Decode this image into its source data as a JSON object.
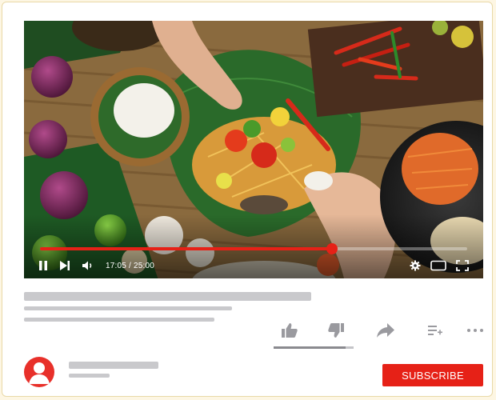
{
  "player": {
    "current_time": "17:05",
    "duration": "25:00",
    "time_separator": " / ",
    "progress_fraction": 0.6833,
    "accent_color": "#e62117",
    "controls": {
      "play_pause": "pause-icon",
      "next": "next-icon",
      "volume": "volume-icon",
      "settings": "gear-icon",
      "miniplayer": "miniplayer-icon",
      "fullscreen": "fullscreen-icon"
    }
  },
  "video_meta": {
    "title": "",
    "description_lines": []
  },
  "actions": {
    "icons": [
      "thumbs-up-icon",
      "thumbs-down-icon",
      "share-icon",
      "add-to-playlist-icon",
      "more-icon"
    ],
    "like_ratio": 0.9
  },
  "channel": {
    "avatar_icon": "user-avatar-icon",
    "avatar_color": "#e8302a",
    "subscribe_label": "SUBSCRIBE",
    "subscribe_color": "#e62117"
  }
}
